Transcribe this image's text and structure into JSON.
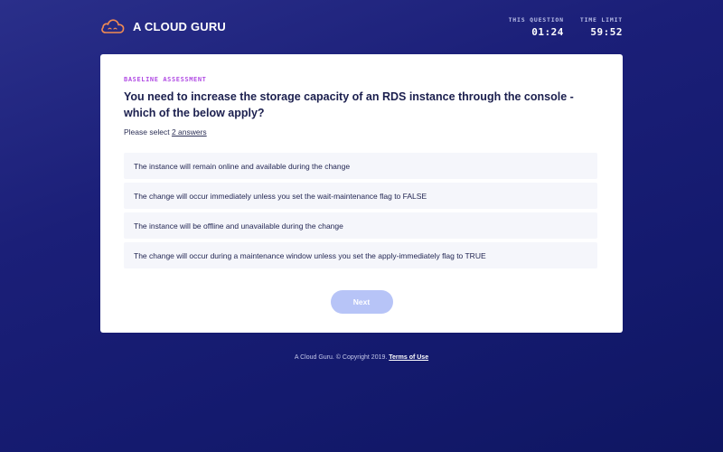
{
  "brand": {
    "name": "A CLOUD GURU",
    "logo_icon": "cloud-icon",
    "accent": "#f28b52"
  },
  "timers": [
    {
      "label": "THIS QUESTION",
      "value": "01:24"
    },
    {
      "label": "TIME LIMIT",
      "value": "59:52"
    }
  ],
  "assessment": {
    "eyebrow": "BASELINE ASSESSMENT",
    "question": "You need to increase the storage capacity of an RDS instance through the console - which of the below apply?",
    "select_prefix": "Please select",
    "select_link": "2 answers",
    "options": [
      "The instance will remain online and available during the change",
      "The change will occur immediately unless you set the wait-maintenance flag to FALSE",
      "The instance will be offline and unavailable during the change",
      "The change will occur during a maintenance window unless you set the apply-immediately flag to TRUE"
    ],
    "next_label": "Next"
  },
  "footer": {
    "copyright": "A Cloud Guru. © Copyright 2019.",
    "terms_label": "Terms of Use"
  },
  "colors": {
    "background": "#1b1f78",
    "eyebrow": "#b14ce4",
    "button_disabled": "#b7c4f7"
  }
}
